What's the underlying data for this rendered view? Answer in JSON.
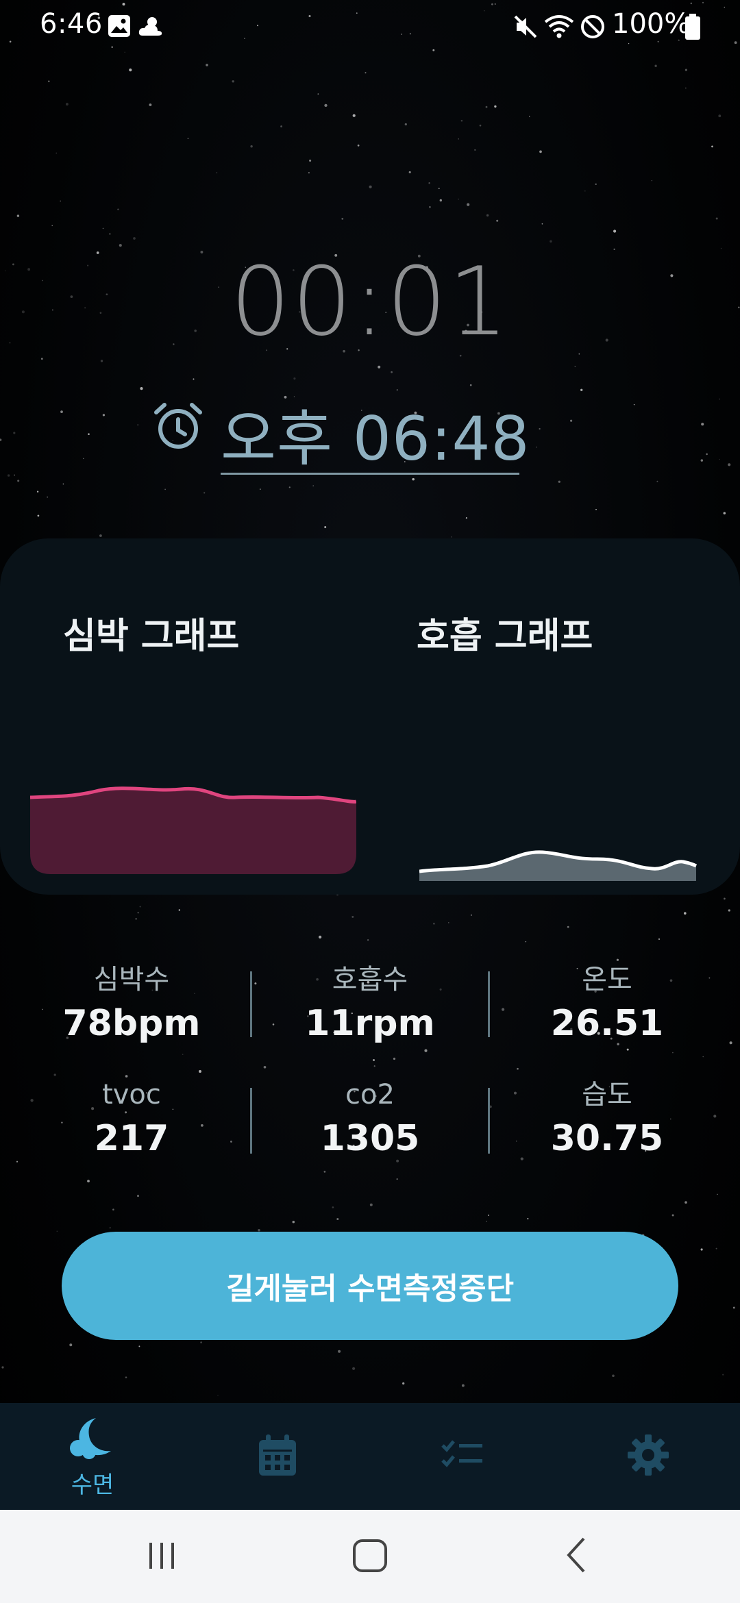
{
  "status_bar": {
    "time": "6:46",
    "battery": "100%",
    "icons": [
      "image-icon",
      "weather-icon",
      "mute-icon",
      "wifi-icon",
      "do-not-disturb-icon",
      "battery-icon"
    ]
  },
  "timer": {
    "elapsed": "00:01",
    "alarm_time": "오후 06:48"
  },
  "graphs": {
    "heart_title": "심박 그래프",
    "breath_title": "호흡 그래프",
    "heart_color": "#e0457f",
    "breath_color": "#ffffff"
  },
  "stats": [
    {
      "label": "심박수",
      "value": "78bpm"
    },
    {
      "label": "호흡수",
      "value": "11rpm"
    },
    {
      "label": "온도",
      "value": "26.51"
    },
    {
      "label": "tvoc",
      "value": "217"
    },
    {
      "label": "co2",
      "value": "1305"
    },
    {
      "label": "습도",
      "value": "30.75"
    }
  ],
  "stop_button": {
    "label": "길게눌러 수면측정중단",
    "color": "#4db4d8"
  },
  "bottom_nav": {
    "items": [
      {
        "icon": "moon-icon",
        "label": "수면",
        "active": true
      },
      {
        "icon": "calendar-icon",
        "label": "",
        "active": false
      },
      {
        "icon": "checklist-icon",
        "label": "",
        "active": false
      },
      {
        "icon": "gear-icon",
        "label": "",
        "active": false
      }
    ],
    "active_color": "#4cb6e2",
    "inactive_color": "#1f4c63"
  },
  "system_nav": {
    "icons": [
      "recent-apps-icon",
      "home-icon",
      "back-icon"
    ]
  }
}
